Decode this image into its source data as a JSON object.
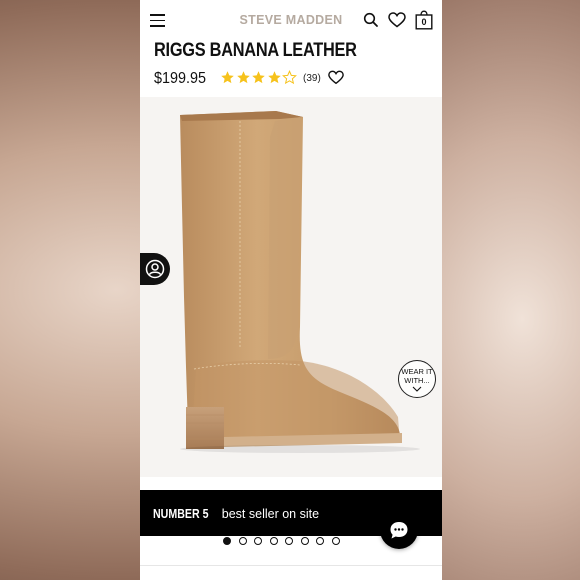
{
  "header": {
    "brand": "STEVE MADDEN",
    "bag_count": "0"
  },
  "product": {
    "title": "RIGGS BANANA LEATHER",
    "price": "$199.95",
    "rating": 4,
    "rating_max": 5,
    "review_count": "(39)"
  },
  "gallery": {
    "wear_it_with_line1": "WEAR IT",
    "wear_it_with_line2": "WITH...",
    "slide_count": 8,
    "active_slide": 1
  },
  "banner": {
    "highlight": "NUMBER 5",
    "text": " best seller on site"
  },
  "colors": {
    "star": "#f6c21c",
    "boot": "#c69b6c",
    "banner_bg": "#000000"
  },
  "icons": [
    "menu-icon",
    "search-icon",
    "heart-icon",
    "bag-icon",
    "star-icon",
    "avatar-icon",
    "chevron-down-icon",
    "chat-icon"
  ]
}
